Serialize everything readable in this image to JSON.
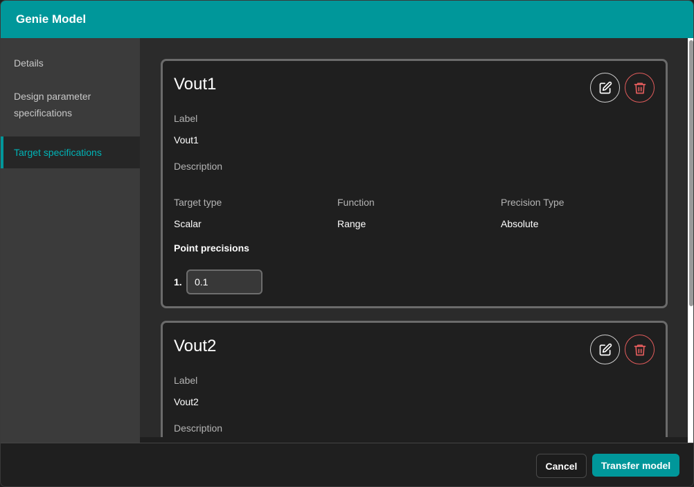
{
  "dialog": {
    "title": "Genie Model"
  },
  "sidebar": {
    "items": [
      {
        "label": "Details"
      },
      {
        "label": "Design parameter specifications"
      },
      {
        "label": "Target specifications"
      }
    ],
    "active_index": 2
  },
  "cards": [
    {
      "title": "Vout1",
      "label_heading": "Label",
      "label_value": "Vout1",
      "description_heading": "Description",
      "description_value": "",
      "target_type_heading": "Target type",
      "target_type_value": "Scalar",
      "function_heading": "Function",
      "function_value": "Range",
      "precision_type_heading": "Precision Type",
      "precision_type_value": "Absolute",
      "point_precisions_heading": "Point precisions",
      "point_precisions": [
        {
          "index_label": "1.",
          "value": "0.1"
        }
      ],
      "edit_icon": "pencil-square-icon",
      "delete_icon": "trash-icon"
    },
    {
      "title": "Vout2",
      "label_heading": "Label",
      "label_value": "Vout2",
      "description_heading": "Description",
      "edit_icon": "pencil-square-icon",
      "delete_icon": "trash-icon"
    }
  ],
  "footer": {
    "cancel_label": "Cancel",
    "transfer_label": "Transfer model"
  },
  "colors": {
    "accent": "#00979a",
    "danger": "#e35c5c",
    "background": "#1f1f1f",
    "sidebar": "#3b3b3b"
  }
}
